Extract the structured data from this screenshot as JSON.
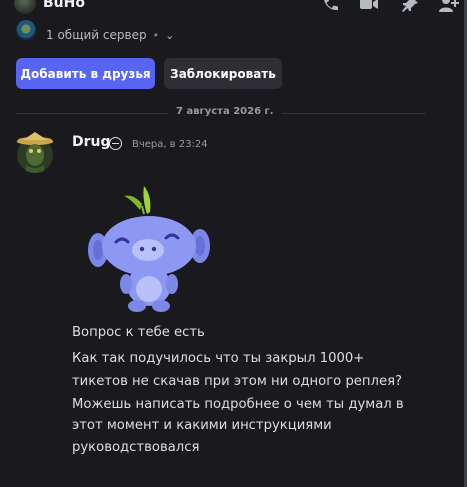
{
  "header": {
    "username": "BuHo",
    "icons": [
      "phone-call-icon",
      "video-call-icon",
      "pin-icon",
      "add-friend-icon"
    ]
  },
  "profile": {
    "mutual_servers": "1 общий сервер",
    "add_friend_label": "Добавить в друзья",
    "block_label": "Заблокировать"
  },
  "chat": {
    "date_divider": "7 августа 2026 г.",
    "message": {
      "author": "Drug",
      "timestamp": "Вчера, в 23:24",
      "sticker": "wumpus-sticker",
      "lines": [
        "Вопрос к тебе есть",
        "Как так подучилось что ты закрыл 1000+",
        "тикетов не скачав при этом ни одного реплея?",
        "Можешь написать подробнее о чем ты думал в",
        "этот момент и какими инструкциями",
        "руководствовался"
      ]
    }
  },
  "colors": {
    "background": "#1a1a1e",
    "primary_button": "#5865f2",
    "secondary_button": "#2e2f34",
    "text": "#dbdee1",
    "muted": "#949ba4"
  }
}
